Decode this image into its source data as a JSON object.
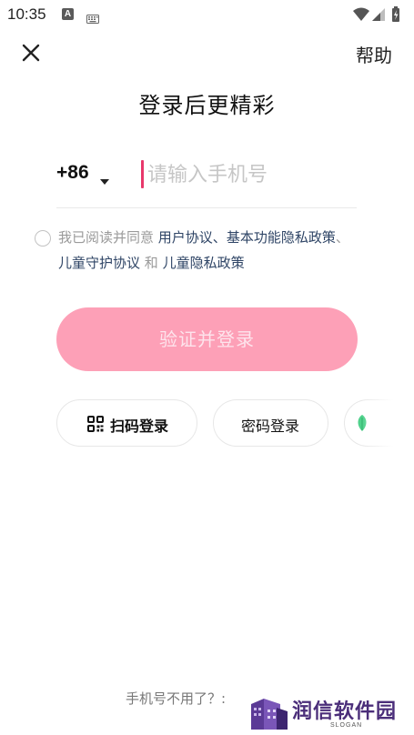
{
  "status_bar": {
    "time": "10:35",
    "left_icons": [
      "a-badge-icon",
      "keyboard-icon"
    ],
    "right_icons": [
      "wifi-icon",
      "signal-icon",
      "battery-icon"
    ]
  },
  "header": {
    "close_icon": "close-icon",
    "help_label": "帮助"
  },
  "title": "登录后更精彩",
  "phone": {
    "country_code": "+86",
    "input_value": "",
    "placeholder": "请输入手机号"
  },
  "agreement": {
    "prefix": "我已阅读并同意 ",
    "link_user": "用户协议",
    "sep1": "、",
    "link_basic_privacy": "基本功能隐私政策",
    "sep2": "、",
    "link_child_protection": "儿童守护协议",
    "and": " 和 ",
    "link_child_privacy": "儿童隐私政策"
  },
  "login_button": "验证并登录",
  "alt_login": {
    "qr_label": "扫码登录",
    "password_label": "密码登录"
  },
  "bottom_link": "手机号不用了？:",
  "watermark": {
    "text": "润信软件园",
    "slogan": "SLOGAN"
  },
  "colors": {
    "accent_pink": "#fda0b7",
    "cursor_pink": "#e8386b",
    "link_blue": "#2f4566",
    "watermark_purple": "#4b2e7a"
  }
}
